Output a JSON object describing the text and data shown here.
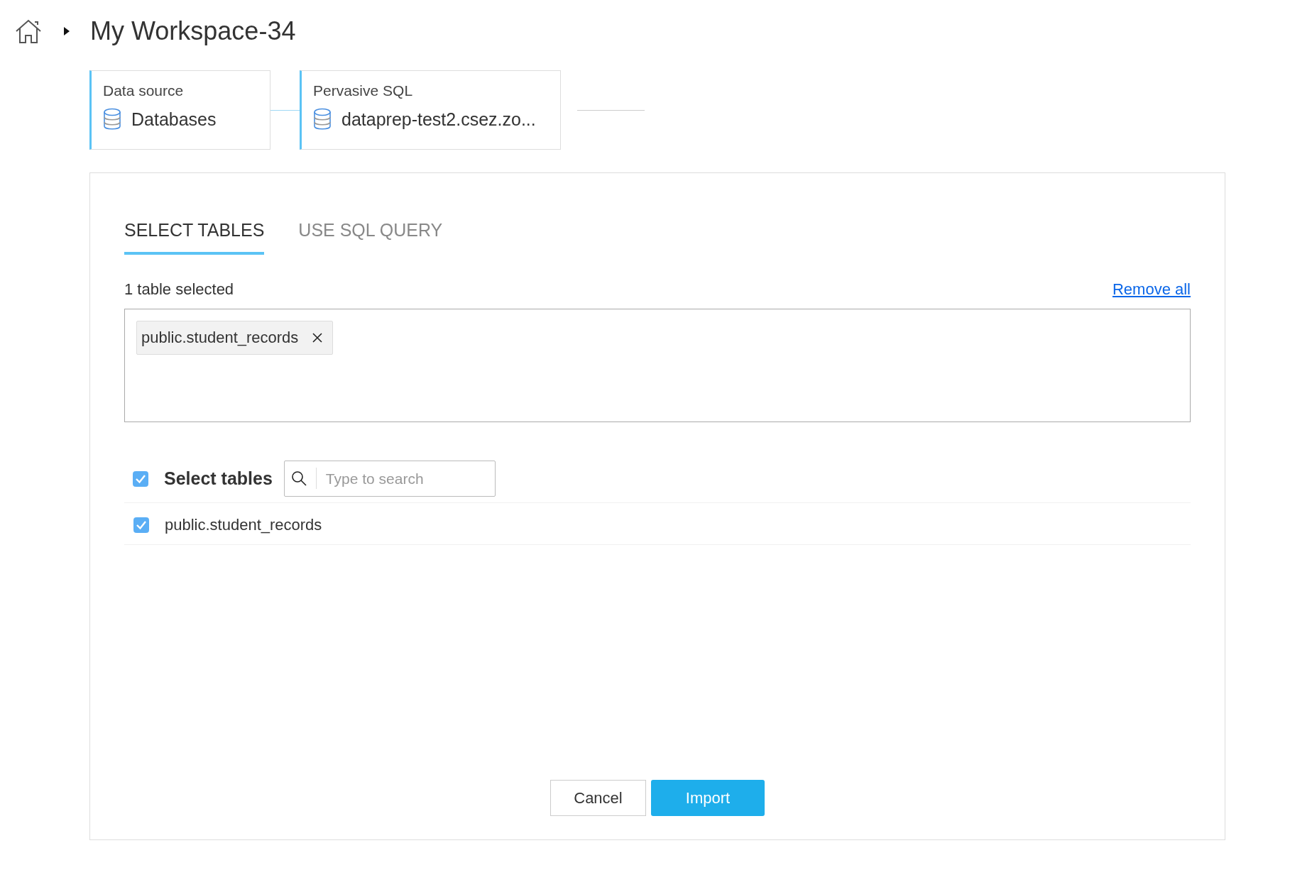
{
  "breadcrumb": {
    "title": "My Workspace-34"
  },
  "steps": [
    {
      "label": "Data source",
      "value": "Databases"
    },
    {
      "label": "Pervasive SQL",
      "value": "dataprep-test2.csez.zo..."
    }
  ],
  "tabs": [
    {
      "label": "SELECT TABLES",
      "selected": true
    },
    {
      "label": "USE SQL QUERY",
      "selected": false
    }
  ],
  "selection": {
    "count_text": "1 table selected",
    "remove_all": "Remove all",
    "chips": [
      "public.student_records"
    ]
  },
  "table_list": {
    "header": {
      "label": "Select tables",
      "checked": true
    },
    "search": {
      "placeholder": "Type to search"
    },
    "items": [
      {
        "name": "public.student_records",
        "checked": true
      }
    ]
  },
  "buttons": {
    "cancel": "Cancel",
    "import": "Import"
  }
}
